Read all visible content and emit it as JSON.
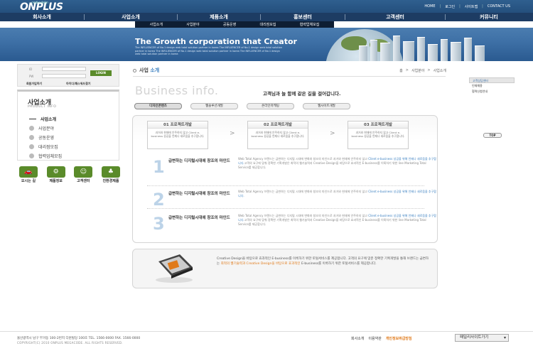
{
  "header": {
    "logo": "ONPLUS",
    "logo_tag": "creative design",
    "util_links": [
      "HOME",
      "로그인",
      "사이트맵",
      "CONTACT US"
    ],
    "gnb": [
      "회사소개",
      "사업소개",
      "제품소개",
      "홍보센터",
      "고객센터",
      "커뮤니티"
    ],
    "snb": [
      "사업소개",
      "사업분야",
      "공동운영",
      "대리점모집",
      "협력업체모집"
    ]
  },
  "hero": {
    "title": "The Growth corporation that Creator",
    "desc": "The INFLUENCER of No.1 design web total solution partner in korea The INFLUENCER of No.1 design web total solution partner in korea The INFLUENCER of No.1 design web total solution partner in korea The INFLUENCER of No.1 design web total solution partner in korea"
  },
  "login": {
    "id_label": "ID",
    "pw_label": "PW",
    "button": "LOGIN",
    "join": "회원가입하기",
    "find": "아이디/패스워드찾기"
  },
  "lnb": {
    "title": "사업소개",
    "subtitle": "PRODUCT INFO",
    "items": [
      "사업소개",
      "사업분야",
      "공동운영",
      "대리점모집",
      "협력업체모집"
    ]
  },
  "quick_icons": [
    "오시는 길",
    "제품정보",
    "고객센터",
    "친환경제품"
  ],
  "page": {
    "title_prefix": "사업",
    "title_accent": "소개",
    "breadcrumb": [
      "홈",
      ">",
      "사업분야",
      ">",
      "사업소개"
    ],
    "big_title": "Business info.",
    "slogan": "고객님과 늘 함께 같은 길을 걸어갑니다.",
    "tabs": [
      "디자인콘텐츠",
      "웹솔루션개발",
      "온라인마케팅",
      "웹사이트개발"
    ]
  },
  "steps": [
    {
      "title": "01 프로젝트개발",
      "desc": "과거와 현재에 안주하지 않고 Client e-business 성공을 언제나 새로움을 추구합니다."
    },
    {
      "title": "02 프로젝트개발",
      "desc": "과거와 현재에 안주하지 않고 Client e-business 성공을 언제나 새로움을 추구합니다."
    },
    {
      "title": "03 프로젝트개발",
      "desc": "과거와 현재에 안주하지 않고 Client e-business 성공을 언제나 새로움을 추구합니다."
    }
  ],
  "rows": [
    {
      "num": "1",
      "heading": "급변하는 디지털시대에 창조의 마인드",
      "desc_a": "Web Total Agency 브랜드는 급변하는 디지털 시대에 변화와 창조의 마인드로 과거와 현재에 안주하지 않고 ",
      "desc_hl": "Client e-business 성공을 위해 언제나 새로움을 추구합니다.",
      "desc_b": "고객의 요구에 맞춰 정확한 기획개발은 최적의 웹기술력과 Creative Design을 바탕으로 효과적인 E-business를 이룩하기 위한 line Marketing Total Service를 제공합니다."
    },
    {
      "num": "2",
      "heading": "급변하는 디지털시대에 창조의 마인드",
      "desc_a": "Web Total Agency 브랜드는 급변하는 디지털 시대에 변화와 창조의 마인드로 과거와 현재에 안주하지 않고 ",
      "desc_hl": "Client e-business 성공을 위해 언제나 새로움을 추구합니다.",
      "desc_b": ""
    },
    {
      "num": "3",
      "heading": "급변하는 디지털시대에 창조의 마인드",
      "desc_a": "Web Total Agency 브랜드는 급변하는 디지털 시대에 변화와 창조의 마인드로 과거와 현재에 안주하지 않고 ",
      "desc_hl": "Client e-business 성공을 위해 언제나 새로움을 추구합니다.",
      "desc_b": "고객의 요구에 맞춰 정확한 기획개발은 최적의 웹기술력과 Creative Design을 바탕으로 효과적인 E-business를 이룩하기 위한 line Marketing Total Service를 제공합니다."
    }
  ],
  "promo": {
    "line1": "Creative Design을 바탕으로 효과적인 E-business를 이룩하기 위한 토털서비스를 제공합니다. 고객의 요구에 맞춘 정확한 기획개발을 통해 브랜드는 급변하는 ",
    "hl": "최적의 웹기술력과 Creative Design을 바탕으로 효과적인",
    "line2": " E-business를 이룩하기 위한 토털서비스를 제공합니다."
  },
  "right_quick": [
    "고객상담센터",
    "인재채용",
    "협력신청안내"
  ],
  "top_button": "TOP",
  "footer": {
    "address": "울산광역시 남구 무거동 100-2번지 다윈빌딩 100호  TEL. 1566-0000      FAX. 1566-0000",
    "copyright": "COPYRIGHT(C) 2010 ONPLUS MEGACODE. ALL RIGHTS RESERVED.",
    "links": [
      "회사소개",
      "이용약관",
      "개인정보취급방침"
    ],
    "family_site": "패밀리사이트가기"
  }
}
